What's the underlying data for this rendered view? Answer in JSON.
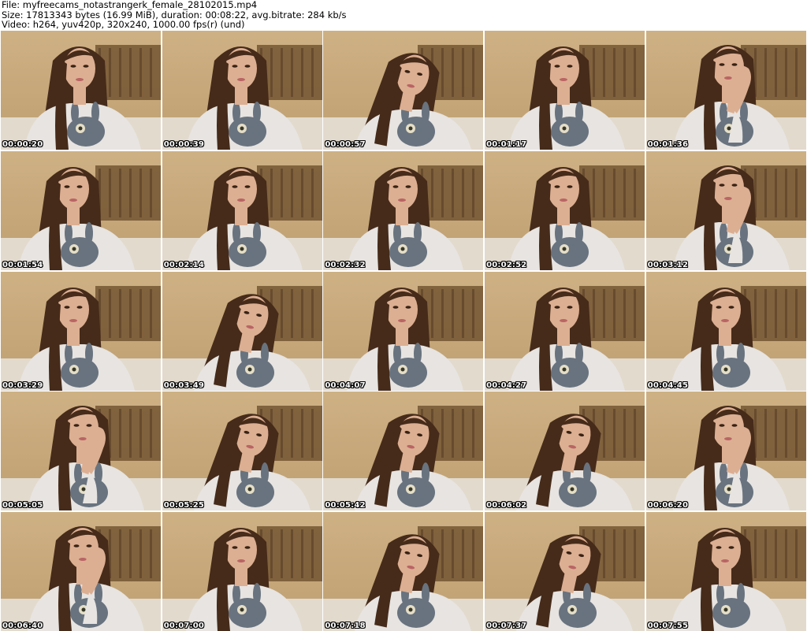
{
  "header": {
    "file_line": "File: myfreecams_notastrangerk_female_28102015.mp4",
    "size_line": "Size: 17813343 bytes (16.99 MiB), duration: 00:08:22, avg.bitrate: 284 kb/s",
    "video_line": "Video: h264, yuv420p, 320x240, 1000.00 fps(r) (und)"
  },
  "thumbnails": [
    {
      "timestamp": "00:00:20",
      "pose": "center"
    },
    {
      "timestamp": "00:00:39",
      "pose": "center"
    },
    {
      "timestamp": "00:00:57",
      "pose": "head-down"
    },
    {
      "timestamp": "00:01:17",
      "pose": "center"
    },
    {
      "timestamp": "00:01:36",
      "pose": "hand-face"
    },
    {
      "timestamp": "00:01:54",
      "pose": "left"
    },
    {
      "timestamp": "00:02:14",
      "pose": "center"
    },
    {
      "timestamp": "00:02:32",
      "pose": "center"
    },
    {
      "timestamp": "00:02:52",
      "pose": "center"
    },
    {
      "timestamp": "00:03:12",
      "pose": "hand-face"
    },
    {
      "timestamp": "00:03:29",
      "pose": "left"
    },
    {
      "timestamp": "00:03:49",
      "pose": "head-down"
    },
    {
      "timestamp": "00:04:07",
      "pose": "center"
    },
    {
      "timestamp": "00:04:27",
      "pose": "center"
    },
    {
      "timestamp": "00:04:45",
      "pose": "center"
    },
    {
      "timestamp": "00:05:05",
      "pose": "hand-face"
    },
    {
      "timestamp": "00:05:25",
      "pose": "head-down"
    },
    {
      "timestamp": "00:05:42",
      "pose": "head-down"
    },
    {
      "timestamp": "00:06:02",
      "pose": "head-down"
    },
    {
      "timestamp": "00:06:20",
      "pose": "hand-face"
    },
    {
      "timestamp": "00:06:40",
      "pose": "hand-face"
    },
    {
      "timestamp": "00:07:00",
      "pose": "center"
    },
    {
      "timestamp": "00:07:18",
      "pose": "head-down"
    },
    {
      "timestamp": "00:07:37",
      "pose": "head-down"
    },
    {
      "timestamp": "00:07:55",
      "pose": "center"
    }
  ],
  "colors": {
    "background": "#ffffff",
    "wall": "#c9a777",
    "headboard": "#7a5a36",
    "hair": "#4a2e1c",
    "skin": "#e8b99a",
    "sweater": "#f4f1ee",
    "print": "#6f7a86",
    "timestamp_text": "#ffffff"
  }
}
